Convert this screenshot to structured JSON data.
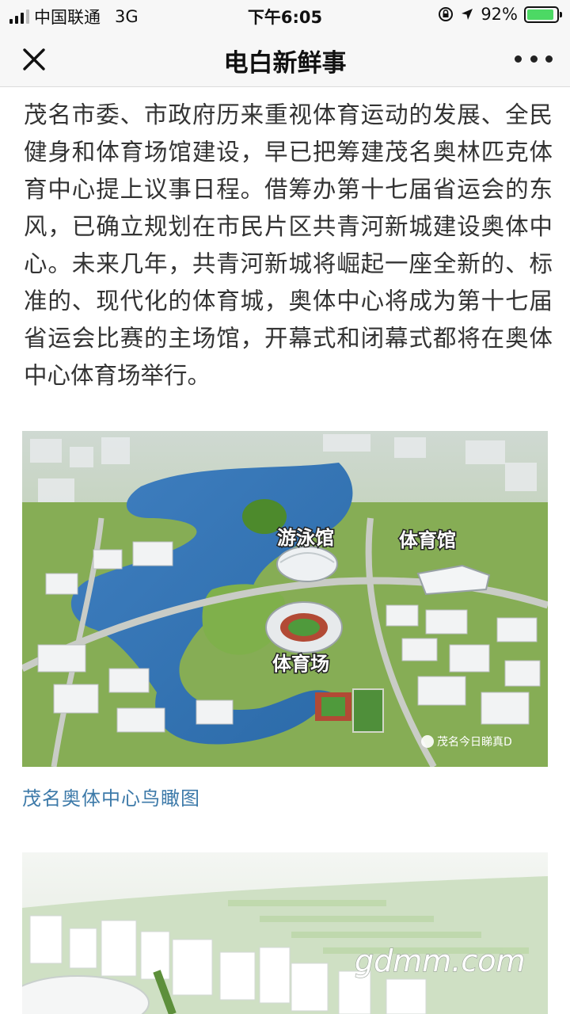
{
  "status_bar": {
    "carrier": "中国联通",
    "network": "3G",
    "time": "下午6:05",
    "battery_level": "92%",
    "battery_fraction": 0.92,
    "signal_bars_filled": 3,
    "signal_bars_total": 4
  },
  "nav": {
    "title": "电白新鲜事"
  },
  "article": {
    "paragraph": "茂名市委、市政府历来重视体育运动的发展、全民健身和体育场馆建设，早已把筹建茂名奥林匹克体育中心提上议事日程。借筹办第十七届省运会的东风，已确立规划在市民片区共青河新城建设奥体中心。未来几年，共青河新城将崛起一座全新的、标准的、现代化的体育城，奥体中心将成为第十七届省运会比赛的主场馆，开幕式和闭幕式都将在奥体中心体育场举行。"
  },
  "figure1": {
    "labels": {
      "swimming": "游泳馆",
      "gym": "体育馆",
      "stadium": "体育场"
    },
    "watermark": "茂名今日睇真D",
    "caption": "茂名奥体中心鸟瞰图"
  },
  "figure2": {
    "watermark": "gdmm.com"
  },
  "colors": {
    "caption": "#3d7aa9",
    "battery": "#4cd964",
    "bar_bg": "#f7f7f7"
  }
}
